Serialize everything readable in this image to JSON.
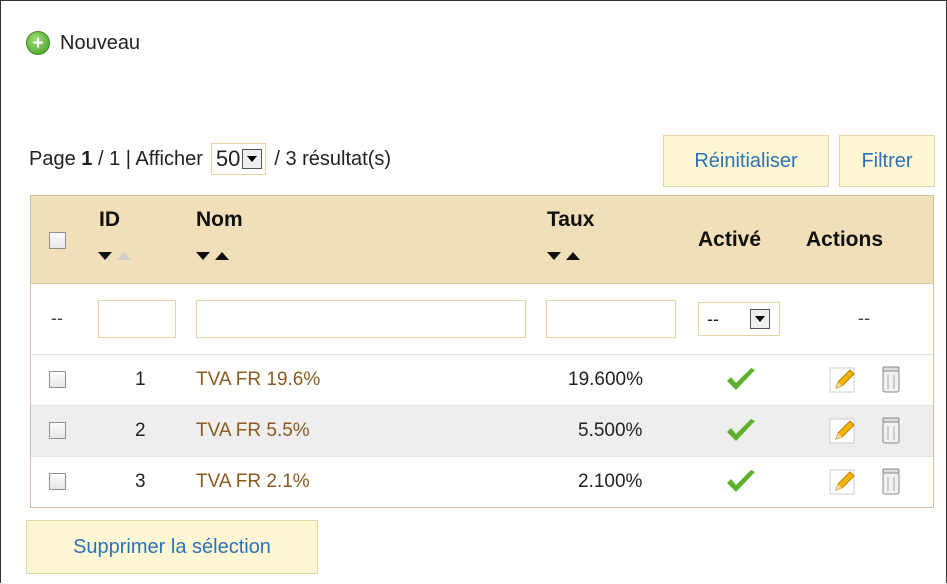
{
  "toolbar": {
    "new_label": "Nouveau"
  },
  "pagination": {
    "page_prefix": "Page",
    "current_page": "1",
    "separator_total": "/ 1 | Afficher",
    "per_page": "50",
    "results": "/ 3 résultat(s)"
  },
  "buttons": {
    "reset": "Réinitialiser",
    "filter": "Filtrer",
    "bulk_delete": "Supprimer la sélection"
  },
  "table": {
    "headers": {
      "id": "ID",
      "name": "Nom",
      "rate": "Taux",
      "active": "Activé",
      "actions": "Actions"
    },
    "filter": {
      "placeholder_dash": "--",
      "active_select": "--",
      "actions_dash": "--"
    },
    "rows": [
      {
        "id": "1",
        "name": "TVA FR 19.6%",
        "rate": "19.600%",
        "active": true
      },
      {
        "id": "2",
        "name": "TVA FR 5.5%",
        "rate": "5.500%",
        "active": true
      },
      {
        "id": "3",
        "name": "TVA FR 2.1%",
        "rate": "2.100%",
        "active": true
      }
    ]
  },
  "colors": {
    "header_bg": "#f0dfb8",
    "button_bg": "#fff6d3",
    "link_blue": "#2b73b8",
    "name_brown": "#8a5a1e",
    "check_green": "#5cb02c"
  },
  "icons": {
    "new": "add-icon",
    "active": "checkmark-icon",
    "edit": "pencil-icon",
    "delete": "trash-icon",
    "sort_desc": "sort-down-icon",
    "sort_asc": "sort-up-icon"
  }
}
